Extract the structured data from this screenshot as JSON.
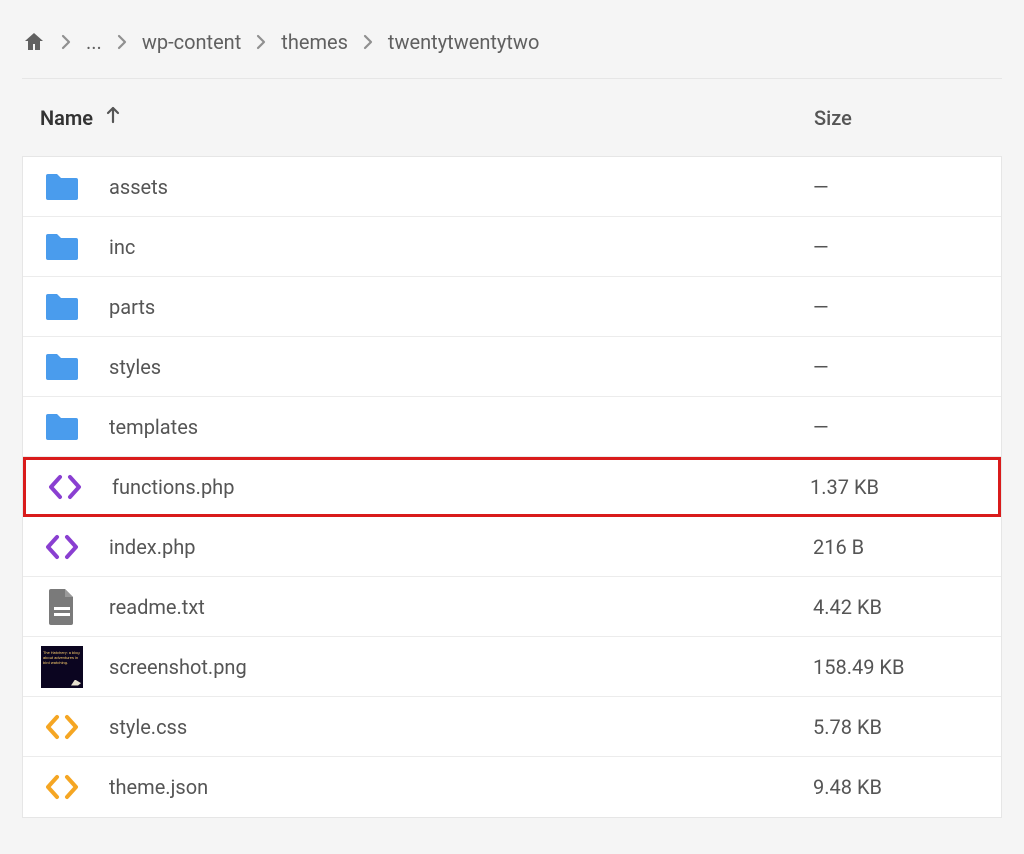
{
  "breadcrumb": {
    "ellipsis": "...",
    "items": [
      "wp-content",
      "themes",
      "twentytwentytwo"
    ]
  },
  "columns": {
    "name": "Name",
    "size": "Size"
  },
  "rows": [
    {
      "icon": "folder",
      "name": "assets",
      "size": "—",
      "highlight": false
    },
    {
      "icon": "folder",
      "name": "inc",
      "size": "—",
      "highlight": false
    },
    {
      "icon": "folder",
      "name": "parts",
      "size": "—",
      "highlight": false
    },
    {
      "icon": "folder",
      "name": "styles",
      "size": "—",
      "highlight": false
    },
    {
      "icon": "folder",
      "name": "templates",
      "size": "—",
      "highlight": false
    },
    {
      "icon": "code-purple",
      "name": "functions.php",
      "size": "1.37 KB",
      "highlight": true
    },
    {
      "icon": "code-purple",
      "name": "index.php",
      "size": "216 B",
      "highlight": false
    },
    {
      "icon": "doc",
      "name": "readme.txt",
      "size": "4.42 KB",
      "highlight": false
    },
    {
      "icon": "thumbnail",
      "name": "screenshot.png",
      "size": "158.49 KB",
      "highlight": false
    },
    {
      "icon": "code-orange",
      "name": "style.css",
      "size": "5.78 KB",
      "highlight": false
    },
    {
      "icon": "code-orange",
      "name": "theme.json",
      "size": "9.48 KB",
      "highlight": false
    }
  ],
  "colors": {
    "folder": "#4a9ced",
    "codePurple": "#8a3fd1",
    "codeOrange": "#f5a623",
    "doc": "#7a7a7a"
  }
}
